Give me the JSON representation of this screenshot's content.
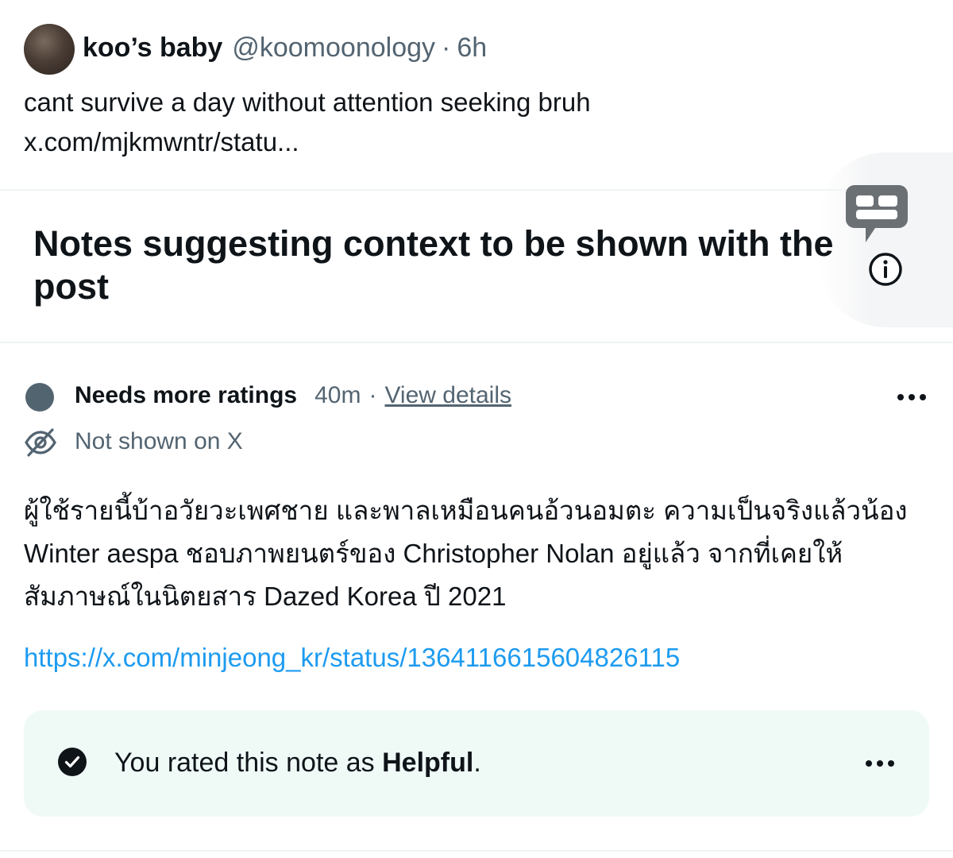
{
  "post": {
    "display_name": "koo’s baby",
    "handle": "@koomoonology",
    "separator": "·",
    "time": "6h",
    "text_lines": [
      "cant survive a day without attention seeking bruh",
      "x.com/mjkmwntr/statu..."
    ]
  },
  "notes_section": {
    "title": "Notes suggesting context to be shown with the post",
    "icons": [
      "community-notes-icon",
      "info-icon"
    ]
  },
  "note": {
    "status": "Needs more ratings",
    "time": "40m",
    "separator": "·",
    "view_details": "View details",
    "visibility": "Not shown on X",
    "body_lines": [
      "ผู้ใช้รายนี้บ้าอวัยวะเพศชาย และพาลเหมือนคนอ้วนอมตะ ความเป็นจริงแล้วน้อง",
      "Winter aespa ชอบภาพยนตร์ของ Christopher Nolan อยู่แล้ว จากที่เคยให้",
      "สัมภาษณ์ในนิตยสาร Dazed Korea ปี 2021"
    ],
    "link": "https://x.com/minjeong_kr/status/1364116615604826115",
    "status_dot_color": "#536471"
  },
  "rating": {
    "prefix": "You rated this note as ",
    "value": "Helpful",
    "suffix": ".",
    "background": "#effaf7"
  },
  "colors": {
    "text": "#0f1419",
    "secondary": "#536471",
    "link": "#1d9bf0",
    "divider": "#eff3f4"
  }
}
